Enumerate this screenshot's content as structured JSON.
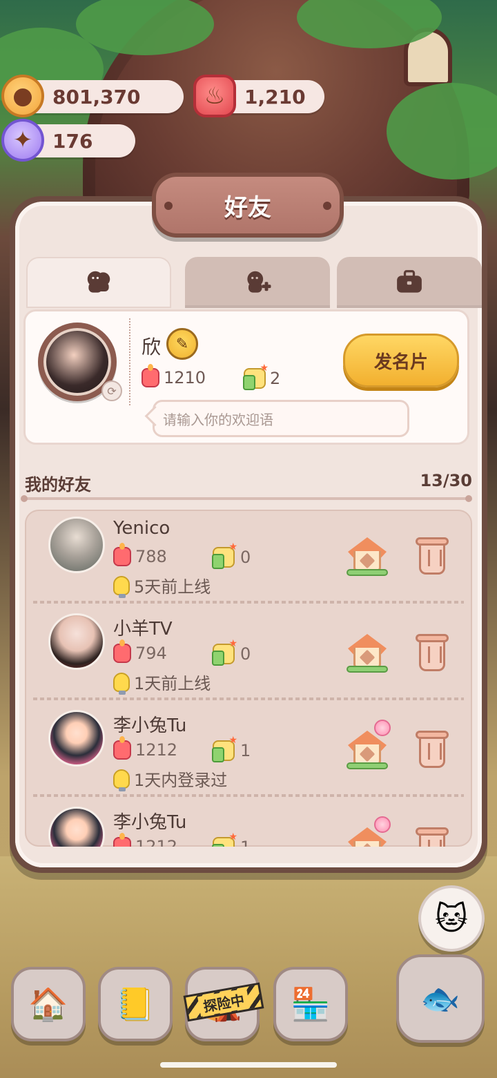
{
  "currencies": {
    "coins": "801,370",
    "candles": "1,210",
    "gems": "176"
  },
  "panel": {
    "title": "好友",
    "tabs": [
      {
        "icon": "friends-icon"
      },
      {
        "icon": "add-friend-icon"
      },
      {
        "icon": "briefcase-icon"
      }
    ]
  },
  "profile": {
    "name": "欣",
    "candles": "1210",
    "likes": "2",
    "greeting_placeholder": "请输入你的欢迎语",
    "send_card_label": "发名片"
  },
  "friends_section": {
    "title": "我的好友",
    "count": "13/30",
    "items": [
      {
        "name": "Yenico",
        "candles": "788",
        "likes": "0",
        "last_online": "5天前上线",
        "avatar_color": "#6d7b72"
      },
      {
        "name": "小羊TV",
        "candles": "794",
        "likes": "0",
        "last_online": "1天前上线",
        "avatar_color": "#d8c3bd"
      },
      {
        "name": "李小兔Tu",
        "candles": "1212",
        "likes": "1",
        "last_online": "1天内登录过",
        "avatar_color": "#2b2e3a"
      },
      {
        "name": "李小兔Tu",
        "candles": "1212",
        "likes": "1",
        "last_online": "",
        "avatar_color": "#2b2e3a"
      }
    ]
  },
  "bottom_nav": {
    "explore_badge": "探险中"
  }
}
